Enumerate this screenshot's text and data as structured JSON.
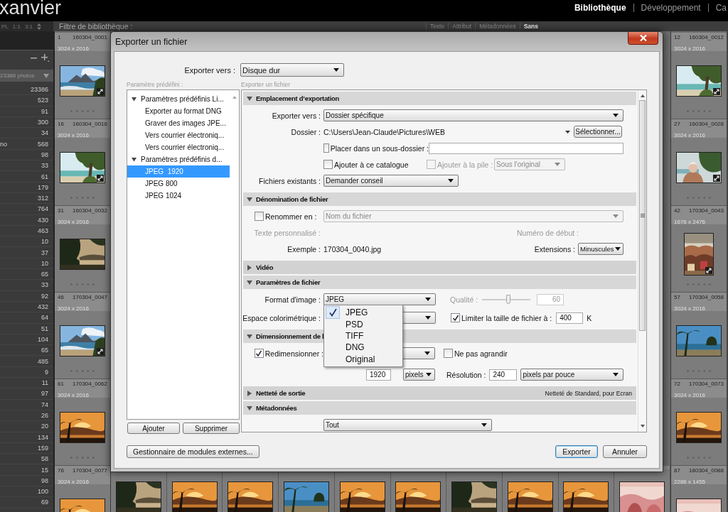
{
  "app": {
    "title": "xanvier",
    "modules": [
      {
        "label": "Bibliothèque",
        "selected": true
      },
      {
        "label": "Développement",
        "selected": false
      },
      {
        "label": "Ca",
        "selected": false
      }
    ]
  },
  "toolbar": {
    "view_options": [
      "PL",
      "1:1",
      "3:1"
    ],
    "filter_label": "Filtre de bibliothèque :",
    "filters": [
      {
        "label": "Texte",
        "selected": false
      },
      {
        "label": "Attribut",
        "selected": false
      },
      {
        "label": "Métadonnées",
        "selected": false
      },
      {
        "label": "Sans",
        "selected": true
      }
    ]
  },
  "left_panel": {
    "source": "23386 photos",
    "counts": [
      {
        "count": "23386"
      },
      {
        "count": "523"
      },
      {
        "count": "91"
      },
      {
        "count": "300"
      },
      {
        "count": "34"
      },
      {
        "label": "no",
        "count": "568"
      },
      {
        "count": "98"
      },
      {
        "count": "33"
      },
      {
        "count": "61"
      },
      {
        "count": "179"
      },
      {
        "count": "312"
      },
      {
        "count": "764"
      },
      {
        "count": "430"
      },
      {
        "count": "463"
      },
      {
        "count": "10"
      },
      {
        "count": "37"
      },
      {
        "count": "10"
      },
      {
        "count": "65"
      },
      {
        "count": "33"
      },
      {
        "count": "92"
      },
      {
        "count": "432"
      },
      {
        "count": "64"
      },
      {
        "count": "51"
      },
      {
        "count": "104"
      },
      {
        "count": "65"
      },
      {
        "count": "485"
      },
      {
        "count": "9"
      },
      {
        "count": "11"
      },
      {
        "count": "97"
      },
      {
        "count": "74"
      },
      {
        "count": "26"
      },
      {
        "count": "20"
      },
      {
        "count": "134"
      },
      {
        "count": "159"
      },
      {
        "count": "58"
      },
      {
        "count": "15"
      },
      {
        "count": "98"
      },
      {
        "count": "100"
      },
      {
        "count": "69"
      }
    ]
  },
  "grid": {
    "left_column": [
      {
        "index": "1",
        "filename": "160304_0001",
        "dimensions": "3024 x 2016",
        "kind": "landscape",
        "edited": true
      },
      {
        "index": "16",
        "filename": "160304_0016",
        "dimensions": "3024 x 2016",
        "kind": "landscape",
        "edited": true
      },
      {
        "index": "31",
        "filename": "160304_0032",
        "dimensions": "3024 x 2016",
        "kind": "landscape",
        "edited": false
      },
      {
        "index": "46",
        "filename": "170304_0047",
        "dimensions": "3024 x 2016",
        "kind": "landscape",
        "edited": true
      },
      {
        "index": "61",
        "filename": "170304_0062",
        "dimensions": "3024 x 2016",
        "kind": "landscape",
        "edited": false
      },
      {
        "index": "76",
        "filename": "170304_0077",
        "dimensions": "3024 x 2016",
        "kind": "landscape",
        "edited": false
      }
    ],
    "right_column": [
      {
        "index": "12",
        "filename": "160304_0012",
        "dimensions": "3024 x 2016",
        "kind": "landscape",
        "edited": true
      },
      {
        "index": "27",
        "filename": "160304_0028",
        "dimensions": "3024 x 2016",
        "kind": "landscape",
        "edited": true
      },
      {
        "index": "42",
        "filename": "170304_0043",
        "dimensions": "1676 x 2476",
        "kind": "portrait",
        "edited": true
      },
      {
        "index": "57",
        "filename": "170304_0058",
        "dimensions": "3024 x 2016",
        "kind": "landscape",
        "edited": false
      },
      {
        "index": "72",
        "filename": "170304_0073",
        "dimensions": "3024 x 2016",
        "kind": "landscape",
        "edited": false
      },
      {
        "index": "87",
        "filename": "180304_0088",
        "dimensions": "2286 x 1455",
        "kind": "landscape",
        "edited": false
      }
    ]
  },
  "dialog": {
    "title": "Exporter un fichier",
    "export_to": {
      "label": "Exporter vers :",
      "value": "Disque dur"
    },
    "presets": {
      "label": "Paramètre prédéfini :",
      "groups": [
        {
          "label": "Paramètres prédéfinis Li...",
          "expanded": true,
          "children": [
            {
              "label": "Exporter au format DNG",
              "selected": false
            },
            {
              "label": "Graver des images JPE...",
              "selected": false
            },
            {
              "label": "Vers courrier électroniq...",
              "selected": false
            },
            {
              "label": "Vers courrier électroniq...",
              "selected": false
            }
          ]
        },
        {
          "label": "Paramètres prédéfinis d...",
          "expanded": true,
          "children": [
            {
              "label": "JPEG  1920",
              "selected": true
            },
            {
              "label": "JPEG 800",
              "selected": false
            },
            {
              "label": "JPEG 1024",
              "selected": false
            }
          ]
        }
      ],
      "buttons": [
        "Ajouter",
        "Supprimer"
      ]
    },
    "settings_label": "Exporter un fichier",
    "sections": [
      {
        "kind": "location",
        "title": "Emplacement d’exportation",
        "expanded": true,
        "export_to": {
          "label": "Exporter vers :",
          "value": "Dossier spécifique"
        },
        "folder": {
          "label": "Dossier :",
          "value": "C:\\Users\\Jean-Claude\\Pictures\\WEB",
          "button": "Sélectionner..."
        },
        "subfolder": {
          "label": "Placer dans un sous-dossier :",
          "checked": false
        },
        "add_to_catalog": {
          "label": "Ajouter à ce catalogue",
          "checked": false
        },
        "add_to_stack": {
          "label": "Ajouter à la pile :",
          "checked": false,
          "disabled": true,
          "value": "Sous l'original"
        },
        "existing_files": {
          "label": "Fichiers existants :",
          "value": "Demander conseil"
        }
      },
      {
        "kind": "naming",
        "title": "Dénomination de fichier",
        "expanded": true,
        "rename": {
          "label": "Renommer en :",
          "checked": false,
          "value": "Nom du fichier",
          "disabled": true
        },
        "custom_text": {
          "label": "Texte personnalisé :",
          "disabled": true
        },
        "start_number": {
          "label": "Numéro de début :",
          "disabled": true
        },
        "example": {
          "label": "Exemple :",
          "value": "170304_0040.jpg"
        },
        "extensions": {
          "label": "Extensions :",
          "value": "Minuscules"
        }
      },
      {
        "kind": "video",
        "title": "Vidéo",
        "expanded": false
      },
      {
        "kind": "file",
        "title": "Paramètres de fichier",
        "expanded": true,
        "format": {
          "label": "Format d'image :",
          "value": "JPEG",
          "open": true,
          "options": [
            {
              "label": "JPEG",
              "selected": true
            },
            {
              "label": "PSD",
              "selected": false
            },
            {
              "label": "TIFF",
              "selected": false
            },
            {
              "label": "DNG",
              "selected": false
            },
            {
              "label": "Original",
              "selected": false
            }
          ]
        },
        "quality": {
          "label": "Qualité :",
          "level": 0.55,
          "value": "60",
          "disabled": true
        },
        "color_space": {
          "label": "Espace colorimétrique :"
        },
        "limit_size": {
          "label": "Limiter la taille de fichier à :",
          "checked": true,
          "value": "400",
          "unit": "K"
        }
      },
      {
        "kind": "sizing",
        "title": "Dimensionnement de l",
        "expanded": true,
        "resize": {
          "label": "Redimensionner :",
          "checked": true
        },
        "no_enlarge": {
          "label": "Ne pas agrandir",
          "checked": false
        },
        "size": {
          "value": "1920",
          "unit": "pixels"
        },
        "resolution": {
          "label": "Résolution :",
          "value": "240",
          "unit": "pixels par pouce"
        }
      },
      {
        "kind": "sharpening",
        "title": "Netteté de sortie",
        "expanded": false,
        "summary": "Netteté de Standard, pour Ecran"
      },
      {
        "kind": "metadata",
        "title": "Métadonnées",
        "expanded": true,
        "include": {
          "value": "Tout"
        }
      }
    ],
    "footer": {
      "plugins_button": "Gestionnaire de modules externes...",
      "export_button": "Exporter",
      "cancel_button": "Annuler"
    }
  }
}
